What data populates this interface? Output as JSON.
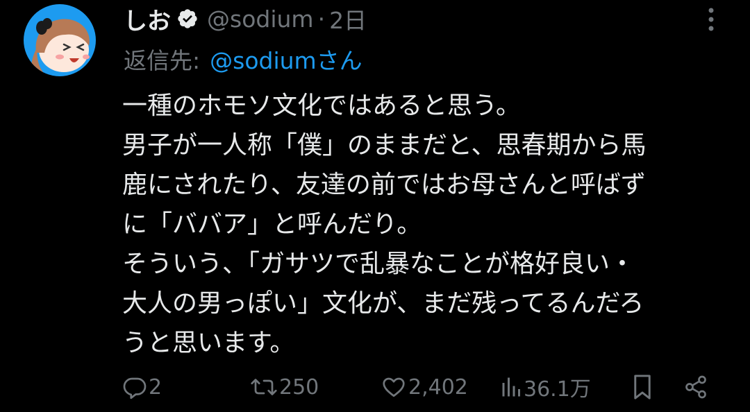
{
  "author": {
    "display_name": "しお",
    "handle": "@sodium",
    "separator": "·",
    "time": "2日",
    "verified": true
  },
  "reply_to": {
    "label": "返信先:",
    "handle": "@sodiumさん"
  },
  "body_lines": [
    "一種のホモソ文化ではあると思う。",
    "男子が一人称「僕」のままだと、思春期から馬",
    "鹿にされたり、友達の前ではお母さんと呼ばず",
    "に「ババア」と呼んだり。",
    "そういう、「ガサツで乱暴なことが格好良い・",
    "大人の男っぽい」文化が、まだ残ってるんだろ",
    "うと思います。"
  ],
  "actions": {
    "replies": "2",
    "reposts": "250",
    "likes": "2,402",
    "views": "36.1万"
  },
  "colors": {
    "background": "#000000",
    "text": "#e7e9ea",
    "secondary": "#71767b",
    "link": "#1d9bf0",
    "avatar_bg": "#1d9bf0"
  },
  "icons": [
    "verified-badge-icon",
    "more-icon",
    "reply-icon",
    "repost-icon",
    "like-icon",
    "views-icon",
    "bookmark-icon",
    "share-icon"
  ]
}
